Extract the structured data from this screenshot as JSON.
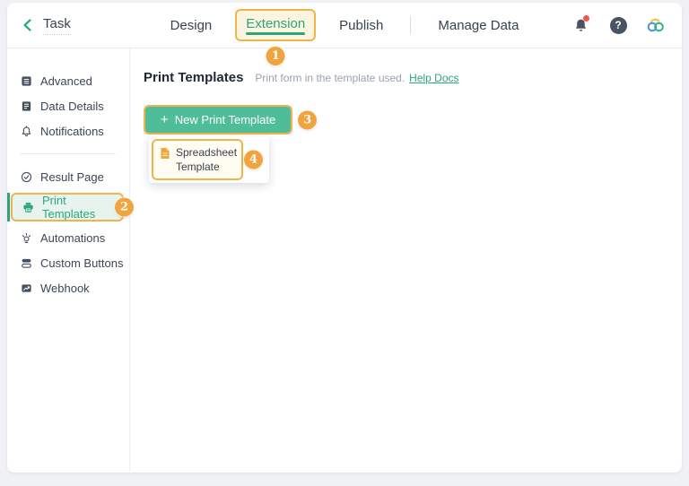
{
  "header": {
    "back_label": "Task",
    "nav": [
      {
        "label": "Design",
        "active": false
      },
      {
        "label": "Extension",
        "active": true
      },
      {
        "label": "Publish",
        "active": false
      },
      {
        "label": "Manage Data",
        "active": false
      }
    ],
    "help_glyph": "?"
  },
  "sidebar": {
    "group1": [
      {
        "icon": "database-icon",
        "label": "Advanced"
      },
      {
        "icon": "document-icon",
        "label": "Data Details"
      },
      {
        "icon": "bell-icon",
        "label": "Notifications"
      }
    ],
    "group2": [
      {
        "icon": "check-circle-icon",
        "label": "Result Page"
      },
      {
        "icon": "printer-icon",
        "label": "Print Templates",
        "active": true
      },
      {
        "icon": "automation-icon",
        "label": "Automations"
      },
      {
        "icon": "custom-buttons-icon",
        "label": "Custom Buttons"
      },
      {
        "icon": "webhook-icon",
        "label": "Webhook"
      }
    ]
  },
  "content": {
    "title": "Print Templates",
    "subtitle": "Print form in the template used.",
    "help_link": "Help Docs",
    "new_template_button": {
      "plus": "+",
      "label": "New Print Template"
    },
    "dropdown": {
      "item_label": "Spreadsheet Template"
    }
  },
  "annotations": {
    "steps": [
      "1",
      "2",
      "3",
      "4"
    ]
  },
  "colors": {
    "accent_green": "#2BA57E",
    "button_green": "#4FBE98",
    "annotation_orange": "#F0A33E",
    "annotation_border": "#F1B34B",
    "sidebar_highlight_bg": "#E7F4EE",
    "tab_highlight_bg": "#FBF5DF",
    "notification_dot": "#F2574B"
  }
}
